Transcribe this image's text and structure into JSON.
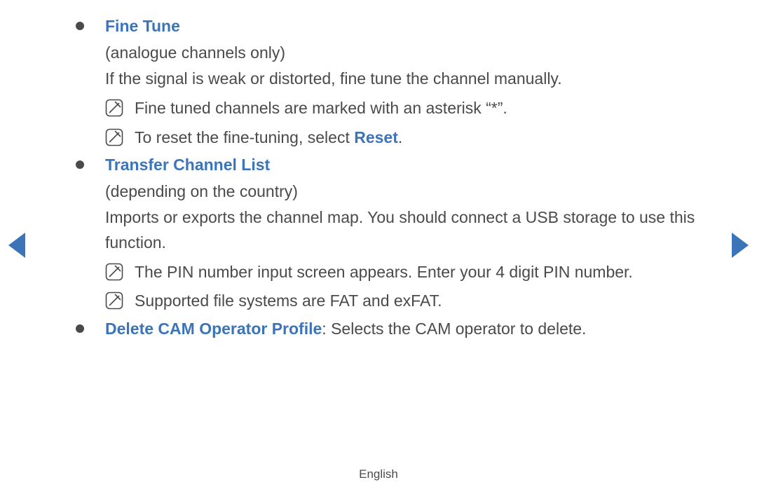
{
  "sections": [
    {
      "heading": "Fine Tune",
      "qualifier": "(analogue channels only)",
      "body": "If the signal is weak or distorted, fine tune the channel manually.",
      "notes": [
        {
          "pre": "Fine tuned channels are marked with an asterisk “*”.",
          "link": "",
          "post": ""
        },
        {
          "pre": "To reset the fine-tuning, select ",
          "link": "Reset",
          "post": "."
        }
      ]
    },
    {
      "heading": "Transfer Channel List",
      "qualifier": "(depending on the country)",
      "body": "Imports or exports the channel map. You should connect a USB storage to use this function.",
      "notes": [
        {
          "pre": "The PIN number input screen appears. Enter your 4 digit PIN number.",
          "link": "",
          "post": ""
        },
        {
          "pre": "Supported file systems are FAT and exFAT.",
          "link": "",
          "post": ""
        }
      ]
    }
  ],
  "delete_profile": {
    "heading": "Delete CAM Operator Profile",
    "sep": ": ",
    "body": "Selects the CAM operator to delete."
  },
  "footer": "English"
}
